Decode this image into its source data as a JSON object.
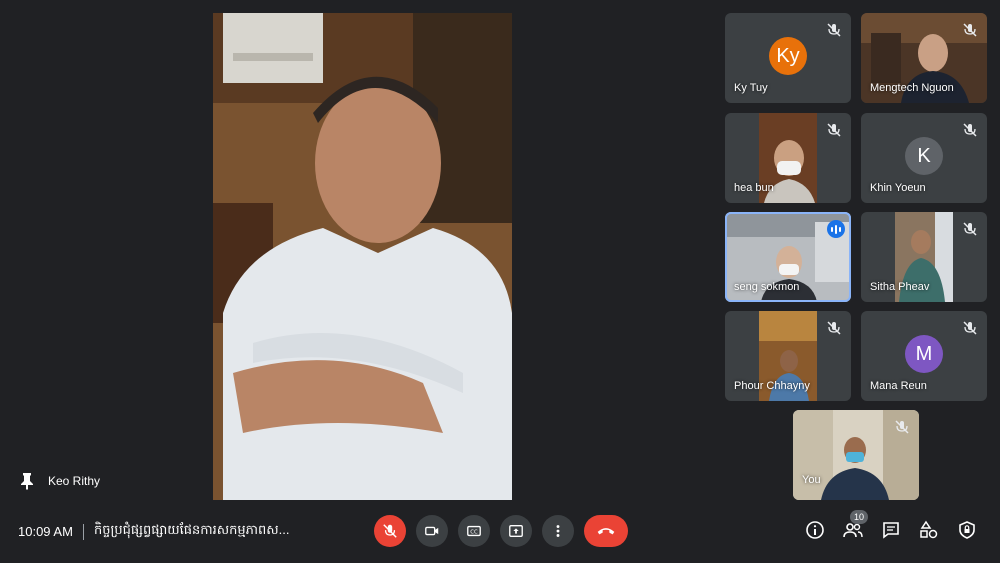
{
  "main_speaker": {
    "name": "Keo Rithy"
  },
  "tiles": [
    {
      "name": "Ky Tuy",
      "initials": "Ky",
      "avatar_color": "#e8710a",
      "muted": true
    },
    {
      "name": "Mengtech Nguon",
      "muted": true,
      "video": true
    },
    {
      "name": "hea bun",
      "muted": true,
      "video": true
    },
    {
      "name": "Khin Yoeun",
      "initials": "K",
      "avatar_color": "#5f6368",
      "muted": true
    },
    {
      "name": "seng sokmon",
      "speaking": true,
      "video": true
    },
    {
      "name": "Sitha Pheav",
      "muted": true,
      "video": true
    },
    {
      "name": "Phour Chhayny",
      "muted": true,
      "video": true
    },
    {
      "name": "Mana Reun",
      "initials": "M",
      "avatar_color": "#7e57c2",
      "muted": true
    },
    {
      "name": "You",
      "muted": true,
      "video": true
    }
  ],
  "bottom": {
    "time": "10:09 AM",
    "meeting_title": "កិច្ចប្រជុំផ្សព្វផ្សាយផែនការសកម្មភាពស...",
    "participants_count": "10"
  },
  "colors": {
    "background": "#202124",
    "tile": "#3c4043",
    "accent": "#8ab4f8",
    "danger": "#ea4335"
  }
}
